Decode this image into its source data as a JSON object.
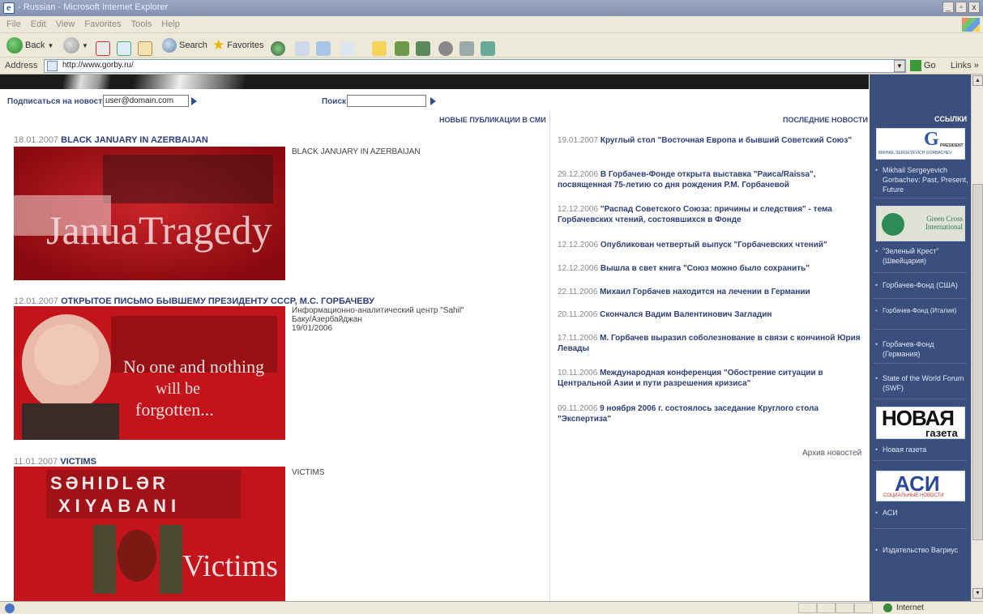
{
  "window": {
    "title": "- Russian - Microsoft Internet Explorer",
    "min": "_",
    "max": "▫",
    "close": "x"
  },
  "menu": [
    "File",
    "Edit",
    "View",
    "Favorites",
    "Tools",
    "Help"
  ],
  "toolbar": {
    "back_label": "Back",
    "search_label": "Search",
    "favorites_label": "Favorites"
  },
  "address": {
    "label": "Address",
    "url": "http://www.gorby.ru/",
    "go_label": "Go",
    "links_label": "Links »"
  },
  "page": {
    "subscribe_label": "Подписаться на новости",
    "subscribe_value": "user@domain.com",
    "search_label": "Поиск",
    "left_heading": "НОВЫЕ ПУБЛИКАЦИИ В СМИ",
    "right_heading": "ПОСЛЕДНИЕ НОВОСТИ",
    "links_heading": "ССЫЛКИ",
    "publications": [
      {
        "date": "18.01.2007",
        "title": "BLACK JANUARY IN AZERBAIJAN",
        "image_text": "JanuaTragedy",
        "desc1": "BLACK JANUARY IN AZERBAIJAN",
        "desc2": "",
        "desc3": ""
      },
      {
        "date": "12.01.2007",
        "title": "ОТКРЫТОЕ ПИСЬМО БЫВШЕМУ ПРЕЗИДЕНТУ СССР, М.С. ГОРБАЧЕВУ",
        "image_text1": "No one and nothing",
        "image_text2": "will be",
        "image_text3": "forgotten...",
        "desc1": "Информационно-аналитический центр \"Sahil\"",
        "desc2": "Баку/Азербайджан",
        "desc3": "19/01/2006"
      },
      {
        "date": "11.01.2007",
        "title": "VICTIMS",
        "image_row1": "SƏHIDLƏR",
        "image_row2": "XIYABANI",
        "image_text": "Victims",
        "desc1": "VICTIMS",
        "desc2": "",
        "desc3": ""
      }
    ],
    "news": [
      {
        "date": "19.01.2007",
        "title": "Круглый стол \"Восточная Европа и бывший Советский Союз\""
      },
      {
        "date": "29.12.2006",
        "title": "В Горбачев-Фонде открыта выставка \"Раиса/Raissa\", посвященная 75-летию со дня рождения Р.М. Горбачевой"
      },
      {
        "date": "12.12.2006",
        "title": "\"Распад Советского Союза: причины и следствия\" - тема Горбачевских чтений, состоявшихся в Фонде"
      },
      {
        "date": "12.12.2006",
        "title": "Опубликован четвертый выпуск \"Горбачевских чтений\""
      },
      {
        "date": "12.12.2006",
        "title": "Вышла в свет книга \"Союз можно было сохранить\""
      },
      {
        "date": "22.11.2006",
        "title": "Михаил Горбачев находится на лечении в Германии"
      },
      {
        "date": "20.11.2006",
        "title": "Скончался Вадим Валентинович Загладин"
      },
      {
        "date": "17.11.2006",
        "title": "М. Горбачев выразил соболезнование в связи с кончиной Юрия Левады"
      },
      {
        "date": "10.11.2006",
        "title": "Международная конференция \"Обострение ситуации в Центральной Азии и пути разрешения кризиса\""
      },
      {
        "date": "09.11.2006",
        "title": "9 ноября 2006 г. состоялось заседание Круглого стола \"Экспертиза\""
      }
    ],
    "archive_label": "Архив новостей",
    "links": [
      {
        "label": "Mikhail Sergeyevich Gorbachev: Past, Present, Future"
      },
      {
        "label": "\"Зеленый Крест\" (Швейцария)"
      },
      {
        "label": "Горбачев-Фонд (США)"
      },
      {
        "label": "Горбачев-Фонд (Италия)"
      },
      {
        "label": "Горбачев-Фонд (Германия)"
      },
      {
        "label": "State of the World Forum (SWF)"
      },
      {
        "label": "Новая газета"
      },
      {
        "label": "АСИ"
      },
      {
        "label": "Издательство Вагриус"
      }
    ],
    "logos": {
      "gorbachev_small": "MIKHAIL SERGEYEVICH GORBACHEV",
      "gorbachev_letter": "G",
      "gorbachev_tag": "PRESIDENT",
      "greencross": "Green Cross International",
      "novaya_top": "НОВАЯ",
      "novaya_bottom": "газета",
      "asi_main": "АСИ",
      "asi_sub": "СОЦИАЛЬНЫЕ НОВОСТИ"
    }
  },
  "status": {
    "zone": "Internet"
  },
  "colors": {
    "accent": "#2e3e78",
    "sidebar": "#3b4f7e",
    "image_red": "#c4141b"
  }
}
